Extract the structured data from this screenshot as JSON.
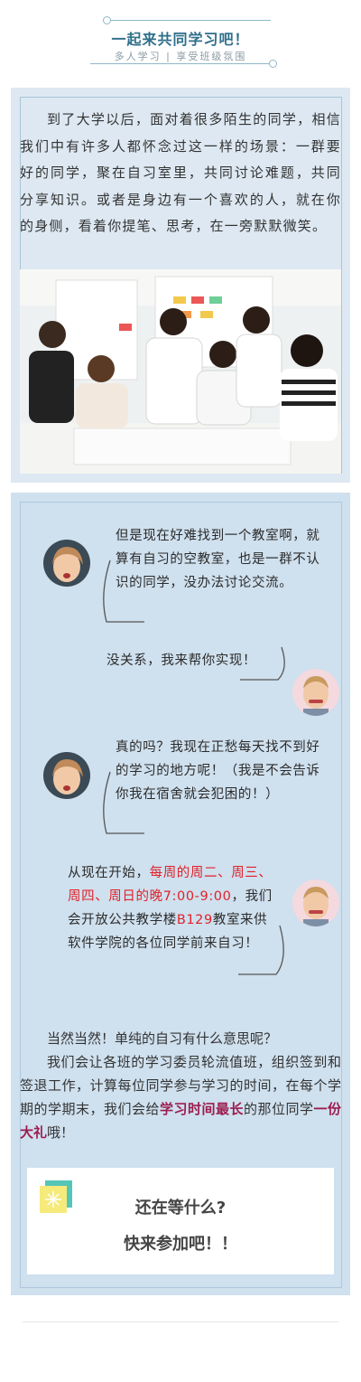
{
  "header": {
    "title": "一起来共同学习吧！",
    "subtitle": "多人学习 | 享受班级氛围"
  },
  "intro": {
    "paragraph": "到了大学以后，面对着很多陌生的同学，相信我们中有许多人都怀念过这一样的场景：一群要好的同学，聚在自习室里，共同讨论难题，共同分享知识。或者是身边有一个喜欢的人，就在你的身侧，看着你提笔、思考，在一旁默默微笑。"
  },
  "chat": {
    "msg1": "但是现在好难找到一个教室啊，就算有自习的空教室，也是一群不认识的同学，没办法讨论交流。",
    "msg2": "没关系，我来帮你实现！",
    "msg3": "真的吗？我现在正愁每天找不到好的学习的地方呢！（我是不会告诉你我在宿舍就会犯困的！）",
    "msg4_prefix": "从现在开始，",
    "msg4_highlight": "每周的周二、周三、周四、周日的晚7:00-9:00",
    "msg4_middle": "，我们会开放公共教学楼",
    "msg4_room": "B129",
    "msg4_suffix": "教室来供软件学院的各位同学前来自习！"
  },
  "closing": {
    "line1": "当然当然！单纯的自习有什么意思呢？",
    "para_prefix": "我们会让各班的学习委员轮流值班，组织签到和签退工作，计算每位同学参与学习的时间，在每个学期的学期末，我们会给",
    "highlight1": "学习时间最长",
    "para_middle": "的那位同学",
    "highlight2": "一份大礼",
    "para_suffix": "哦！"
  },
  "cta": {
    "line1": "还在等什么?",
    "line2": "快来参加吧！！"
  },
  "colors": {
    "accent": "#2f6f8a",
    "red": "#e0222a",
    "wine": "#9c1d4f",
    "teal": "#6ebfcf"
  }
}
